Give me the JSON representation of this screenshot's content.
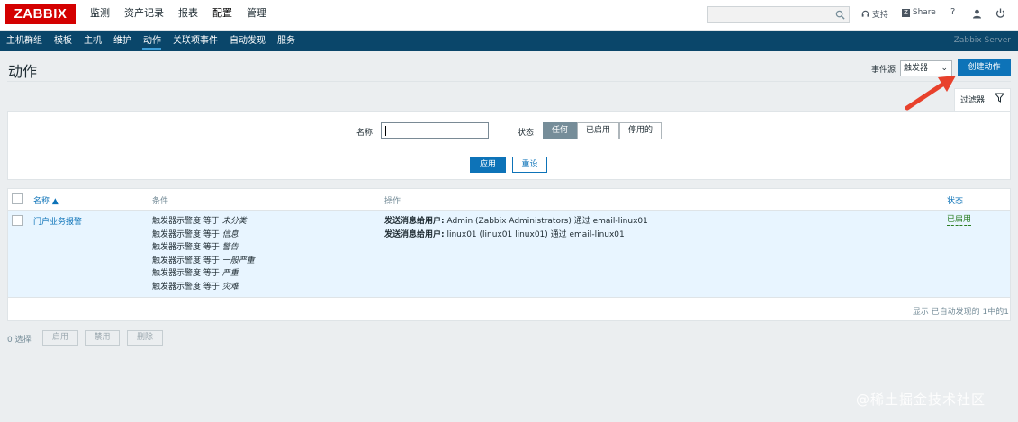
{
  "header": {
    "logo": "ZABBIX",
    "main_menu": [
      "监测",
      "资产记录",
      "报表",
      "配置",
      "管理"
    ],
    "support": "支持",
    "share": "Share",
    "help": "?"
  },
  "submenu": {
    "items": [
      "主机群组",
      "模板",
      "主机",
      "维护",
      "动作",
      "关联项事件",
      "自动发现",
      "服务"
    ],
    "active": "动作",
    "server_name": "Zabbix Server"
  },
  "page": {
    "title": "动作",
    "event_source_label": "事件源",
    "event_source_value": "触发器",
    "create_button": "创建动作"
  },
  "filter": {
    "tab_label": "过滤器",
    "name_label": "名称",
    "name_value": "",
    "status_label": "状态",
    "status_options": [
      "任何",
      "已启用",
      "停用的"
    ],
    "status_selected": "任何",
    "apply_button": "应用",
    "reset_button": "重设"
  },
  "table": {
    "columns": {
      "name": "名称 ▲",
      "conditions": "条件",
      "operations": "操作",
      "status": "状态"
    },
    "rows": [
      {
        "name": "门户业务报警",
        "conditions": [
          {
            "text": "触发器示警度 等于 ",
            "value": "未分类"
          },
          {
            "text": "触发器示警度 等于 ",
            "value": "信息"
          },
          {
            "text": "触发器示警度 等于 ",
            "value": "警告"
          },
          {
            "text": "触发器示警度 等于 ",
            "value": "一般严重"
          },
          {
            "text": "触发器示警度 等于 ",
            "value": "严重"
          },
          {
            "text": "触发器示警度 等于 ",
            "value": "灾难"
          }
        ],
        "operations": [
          {
            "label": "发送消息给用户:",
            "detail": " Admin (Zabbix Administrators) 通过 email-linux01"
          },
          {
            "label": "发送消息给用户:",
            "detail": " linux01 (linux01 linux01) 通过 email-linux01"
          }
        ],
        "status": "已启用"
      }
    ],
    "footer": "显示 已自动发现的 1中的1"
  },
  "bottom": {
    "selected": "0 选择",
    "buttons": [
      "启用",
      "禁用",
      "删除"
    ]
  },
  "watermark": "@稀土掘金技术社区",
  "colors": {
    "brand": "#d40000",
    "nav": "#0a466a",
    "primary": "#0d73b8",
    "enabled": "#2a7d22",
    "annotation_arrow": "#e8412c"
  }
}
